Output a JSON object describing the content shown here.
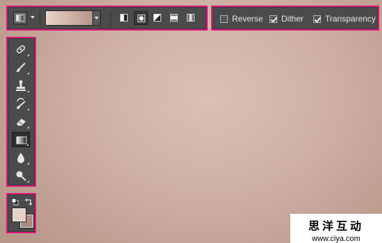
{
  "options_bar": {
    "preset_icon": "gradient-preset-icon",
    "gradient_colors": [
      "#ead3c9",
      "#af8c7f"
    ],
    "gradient_types": [
      {
        "name": "linear-gradient-icon",
        "selected": false
      },
      {
        "name": "radial-gradient-icon",
        "selected": true
      },
      {
        "name": "angle-gradient-icon",
        "selected": false
      },
      {
        "name": "reflected-gradient-icon",
        "selected": false
      },
      {
        "name": "diamond-gradient-icon",
        "selected": false
      }
    ]
  },
  "checks": {
    "reverse_label": "Reverse",
    "reverse_checked": false,
    "dither_label": "Dither",
    "dither_checked": true,
    "transparency_label": "Transparency",
    "transparency_checked": true
  },
  "tools": [
    {
      "icon": "spot-healing-brush-icon",
      "active": false
    },
    {
      "icon": "brush-icon",
      "active": false
    },
    {
      "icon": "clone-stamp-icon",
      "active": false
    },
    {
      "icon": "history-brush-icon",
      "active": false
    },
    {
      "icon": "eraser-icon",
      "active": false
    },
    {
      "icon": "gradient-tool-icon",
      "active": true
    },
    {
      "icon": "blur-icon",
      "active": false
    },
    {
      "icon": "dodge-icon",
      "active": false
    }
  ],
  "colors": {
    "foreground": "#e7d0c6",
    "background": "#ad8b7e",
    "accent_outline": "#e0167c"
  },
  "watermark": {
    "title": "思洋互动",
    "url": "www.ciya.com"
  }
}
